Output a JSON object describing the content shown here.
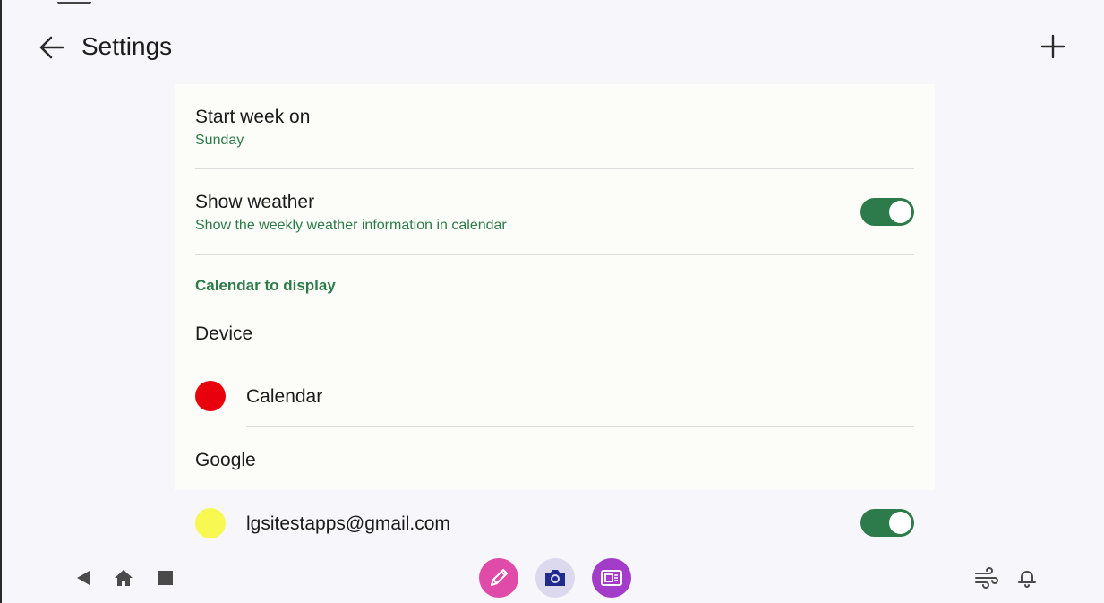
{
  "header": {
    "title": "Settings"
  },
  "settings": {
    "start_week": {
      "label": "Start week on",
      "value": "Sunday"
    },
    "show_weather": {
      "label": "Show weather",
      "description": "Show the weekly weather information in calendar",
      "enabled": true
    },
    "calendar_section": {
      "header": "Calendar to display",
      "groups": [
        {
          "name": "Device",
          "calendars": [
            {
              "name": "Calendar",
              "color": "#e8000d"
            }
          ]
        },
        {
          "name": "Google",
          "calendars": [
            {
              "name": "lgsitestapps@gmail.com",
              "color": "#f8f852",
              "enabled": true
            }
          ]
        }
      ]
    }
  },
  "colors": {
    "accent": "#2d7a4a",
    "background": "#f7f6fa",
    "card": "#fcfdf8"
  },
  "navbar": {
    "system_icons": [
      "back-triangle-icon",
      "home-icon",
      "recents-square-icon"
    ],
    "apps": [
      {
        "name": "pen-app",
        "color": "#e04aa8"
      },
      {
        "name": "camera-app",
        "color": "#dcd9ef"
      },
      {
        "name": "screen-capture-app",
        "color": "#a33cc8"
      }
    ],
    "right_icons": [
      "wind-icon",
      "bell-icon"
    ]
  }
}
